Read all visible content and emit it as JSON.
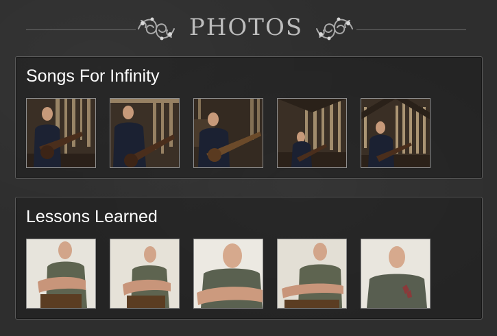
{
  "header": {
    "title": "PHOTOS",
    "left_ornament_icon": "flourish-ornament-icon",
    "right_ornament_icon": "flourish-ornament-icon"
  },
  "albums": [
    {
      "title": "Songs For Infinity",
      "photos": [
        {
          "subject": "guitarist-in-barn"
        },
        {
          "subject": "guitarist-in-barn"
        },
        {
          "subject": "guitarist-in-barn"
        },
        {
          "subject": "guitarist-in-barn"
        },
        {
          "subject": "guitarist-in-barn"
        }
      ]
    },
    {
      "title": "Lessons Learned",
      "photos": [
        {
          "subject": "man-seated-on-chair"
        },
        {
          "subject": "man-seated-on-chair"
        },
        {
          "subject": "man-portrait-closeup"
        },
        {
          "subject": "man-seated-on-chair"
        },
        {
          "subject": "man-portrait"
        }
      ]
    }
  ],
  "colors": {
    "background": "#2e2e2e",
    "panel_border": "#5a5a5a",
    "title_text": "#bdbdbd",
    "album_title_text": "#ffffff"
  }
}
